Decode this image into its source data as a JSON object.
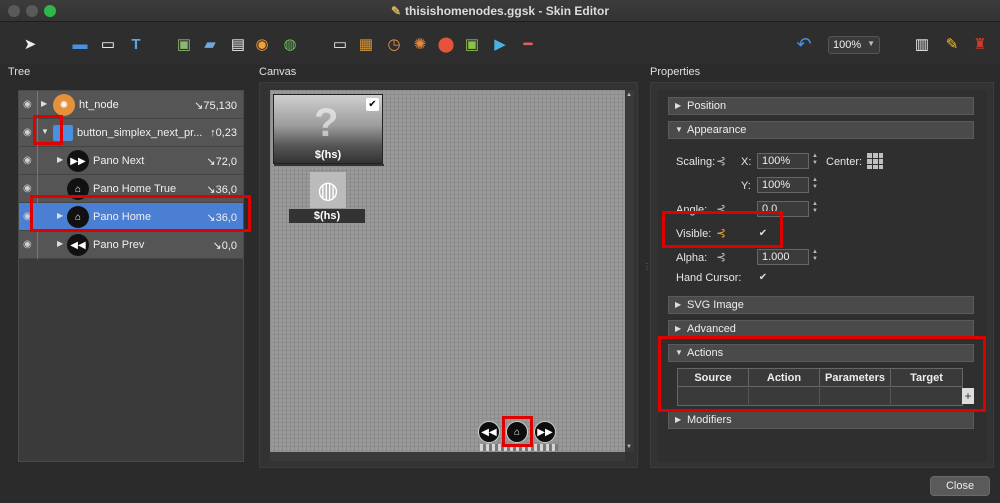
{
  "window": {
    "title": "thisishomenodes.ggsk - Skin Editor"
  },
  "toolbar": {
    "zoom_value": "100%"
  },
  "sections": {
    "tree": "Tree",
    "canvas": "Canvas",
    "properties": "Properties"
  },
  "tree": {
    "rows": [
      {
        "name": "ht_node",
        "position": "↘75,130",
        "icon": "hotspot-node-icon"
      },
      {
        "name": "button_simplex_next_pr...",
        "position": "↑0,23",
        "icon": "folder-icon"
      },
      {
        "name": "Pano Next",
        "position": "↘72,0",
        "icon": "next-icon"
      },
      {
        "name": "Pano Home True",
        "position": "↘36,0",
        "icon": "home-icon"
      },
      {
        "name": "Pano Home",
        "position": "↘36,0",
        "icon": "home-icon"
      },
      {
        "name": "Pano Prev",
        "position": "↘0,0",
        "icon": "prev-icon"
      }
    ]
  },
  "canvas": {
    "thumb_label": "$(hs)",
    "globe_label": "$(hs)"
  },
  "properties": {
    "groups": {
      "position": "Position",
      "appearance": "Appearance",
      "svg_image": "SVG Image",
      "advanced": "Advanced",
      "actions": "Actions",
      "modifiers": "Modifiers"
    },
    "scaling_label": "Scaling:",
    "x_label": "X:",
    "x_value": "100%",
    "center_label": "Center:",
    "y_label": "Y:",
    "y_value": "100%",
    "angle_label": "Angle:",
    "angle_value": "0.0",
    "visible_label": "Visible:",
    "alpha_label": "Alpha:",
    "alpha_value": "1.000",
    "hand_cursor_label": "Hand Cursor:",
    "actions_table": {
      "columns": [
        "Source",
        "Action",
        "Parameters",
        "Target"
      ]
    }
  },
  "footer": {
    "close_label": "Close"
  },
  "colors": {
    "highlight": "#e10000",
    "selection": "#4a7fd4",
    "link_active": "#e8a33d"
  }
}
